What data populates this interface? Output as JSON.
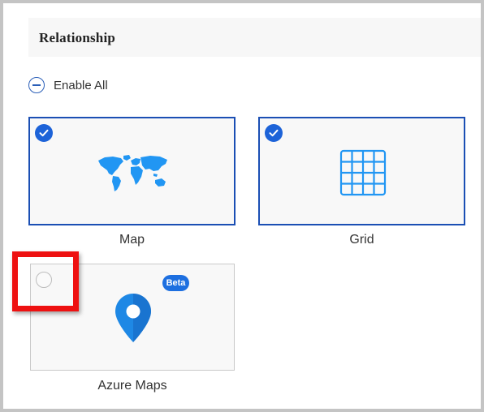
{
  "header": {
    "title": "Relationship"
  },
  "enable_all": {
    "label": "Enable All"
  },
  "cards": [
    {
      "label": "Map",
      "selected": true,
      "icon": "world-map-icon"
    },
    {
      "label": "Grid",
      "selected": true,
      "icon": "grid-icon"
    },
    {
      "label": "Azure Maps",
      "selected": false,
      "icon": "map-pin-icon",
      "badge": "Beta"
    }
  ],
  "colors": {
    "accent": "#1d63d8",
    "selected_border": "#1b4fb4",
    "icon_blue": "#2196f3",
    "highlight": "#ee1111",
    "badge": "#1d6fe0"
  }
}
